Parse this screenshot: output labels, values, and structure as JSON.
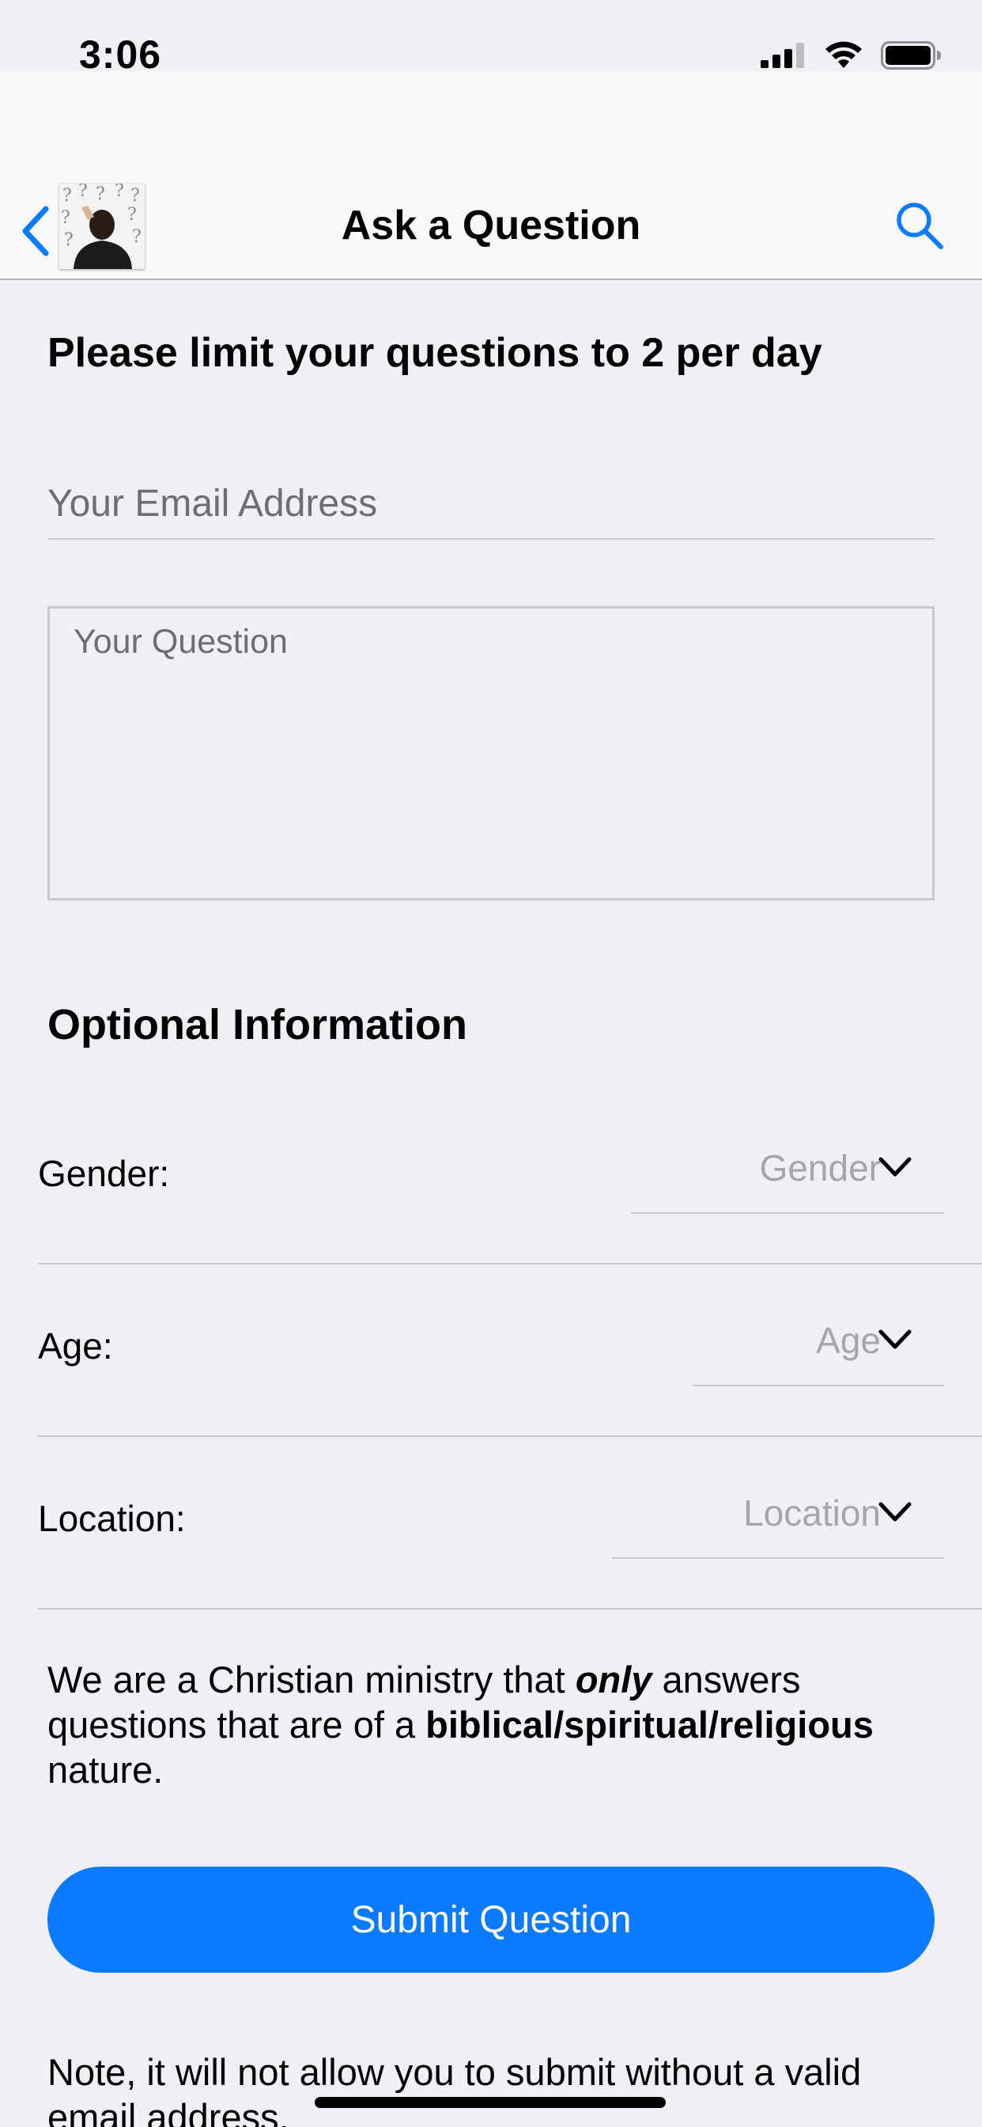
{
  "status_bar": {
    "time": "3:06"
  },
  "nav": {
    "title": "Ask a Question",
    "back_icon": "chevron-left-icon",
    "search_icon": "search-icon",
    "accent_color": "#0a7aff"
  },
  "form": {
    "limit_heading": "Please limit your questions to 2 per day",
    "email_placeholder": "Your Email Address",
    "question_placeholder": "Your Question",
    "optional_heading": "Optional Information",
    "gender": {
      "label": "Gender:",
      "placeholder": "Gender"
    },
    "age": {
      "label": "Age:",
      "placeholder": "Age"
    },
    "location": {
      "label": "Location:",
      "placeholder": "Location"
    },
    "disclaimer": {
      "part1": "We are a Christian ministry that ",
      "emphasis": "only",
      "part2": " answers questions that are of a ",
      "bold": "biblical/spiritual/religious",
      "part3": " nature."
    },
    "submit_label": "Submit Question",
    "note": "Note, it will not allow you to submit without a valid email address."
  }
}
